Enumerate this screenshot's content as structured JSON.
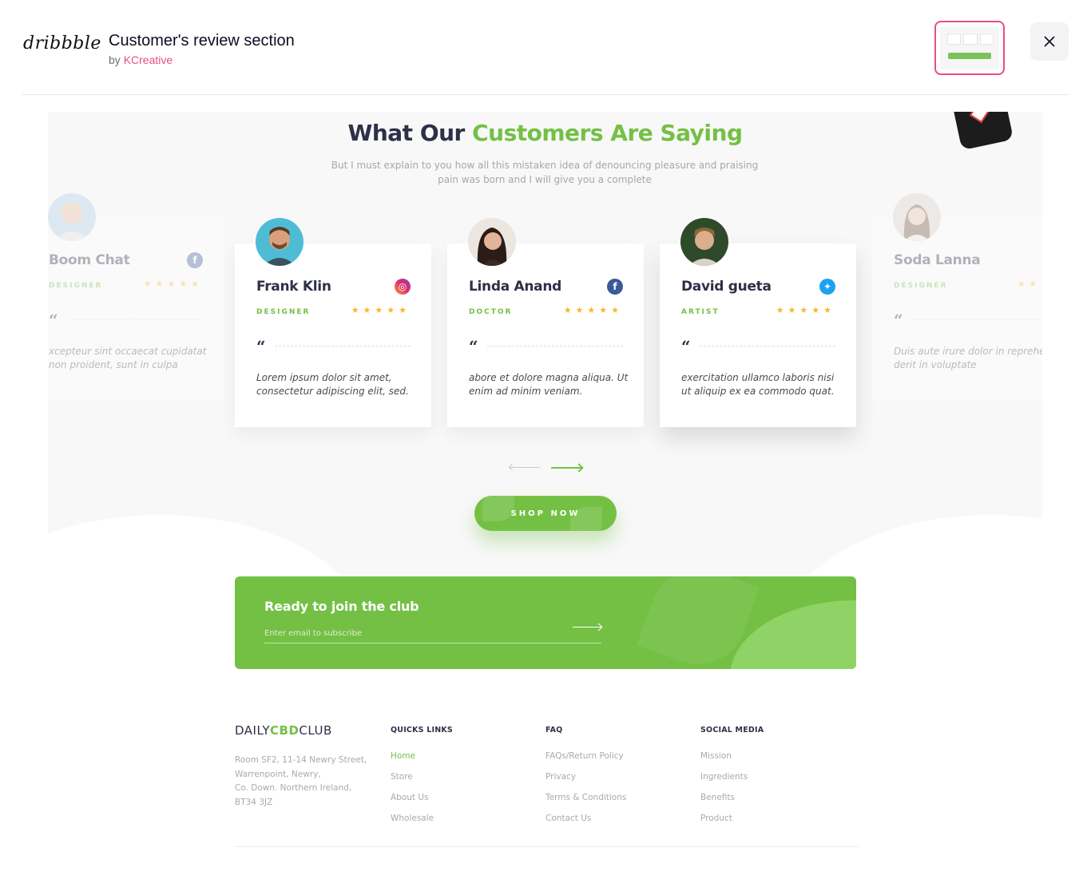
{
  "header": {
    "logo": "dribbble",
    "title": "Customer's review section",
    "by_prefix": "by",
    "author": "KCreative",
    "close_icon": "close-icon"
  },
  "section": {
    "title_dark": "What Our",
    "title_green": "Customers Are Saying",
    "subtitle_line1": "But I must explain to you how all this mistaken idea of denouncing pleasure and praising",
    "subtitle_line2": "pain was born and I will give you a complete"
  },
  "reviews": [
    {
      "name": "Boom Chat",
      "role": "DESIGNER",
      "stars": "★★★★★",
      "quote": "xcepteur sint occaecat cupidatat non proident, sunt in culpa",
      "social": "facebook-icon",
      "social_glyph": "f"
    },
    {
      "name": "Frank Klin",
      "role": "DESIGNER",
      "stars": "★★★★★",
      "quote": "Lorem ipsum dolor sit amet, consectetur adipiscing elit, sed.",
      "social": "instagram-icon",
      "social_glyph": "◎"
    },
    {
      "name": "Linda Anand",
      "role": "DOCTOR",
      "stars": "★★★★★",
      "quote": "abore et dolore magna aliqua. Ut enim ad minim veniam.",
      "social": "facebook-icon",
      "social_glyph": "f"
    },
    {
      "name": "David gueta",
      "role": "ARTIST",
      "stars": "★★★★★",
      "quote": "exercitation ullamco laboris nisi ut aliquip ex ea commodo quat.",
      "social": "twitter-icon",
      "social_glyph": "✦"
    },
    {
      "name": "Soda Lanna",
      "role": "DESIGNER",
      "stars": "★★★★★",
      "quote": "Duis aute irure dolor in reprehen derit in voluptate",
      "social": "facebook-icon",
      "social_glyph": "f"
    }
  ],
  "quote_mark": "“",
  "shop_button": "SHOP NOW",
  "club": {
    "title": "Ready to join the club",
    "placeholder": "Enter email to subscribe"
  },
  "footer": {
    "brand_a": "DAILY",
    "brand_b": "CBD",
    "brand_c": "CLUB",
    "address": [
      "Room SF2, 11-14 Newry Street,",
      "Warrenpoint, Newry,",
      "Co. Down. Northern Ireland,",
      "BT34 3JZ"
    ],
    "columns": [
      {
        "heading": "QUICKS LINKS",
        "links": [
          "Home",
          "Store",
          "About Us",
          "Wholesale"
        ]
      },
      {
        "heading": "FAQ",
        "links": [
          "FAQs/Return Policy",
          "Privacy",
          "Terms & Conditions",
          "Contact Us"
        ]
      },
      {
        "heading": "SOCIAL MEDIA",
        "links": [
          "Mission",
          "Ingredients",
          "Benefits",
          "Product"
        ]
      }
    ]
  },
  "colors": {
    "accent_green": "#74c045",
    "dark_text": "#2d3047",
    "star": "#f7b733",
    "dribbble_pink": "#ea4c89",
    "instagram": "#e1306c",
    "facebook": "#3b5998",
    "twitter": "#1da1f2"
  }
}
